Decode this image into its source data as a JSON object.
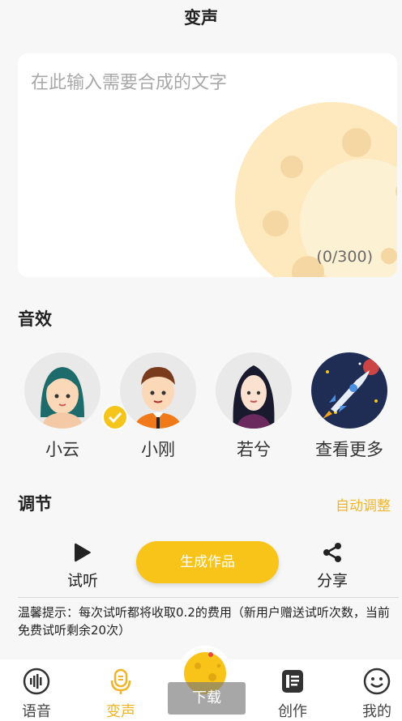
{
  "header": {
    "title": "变声"
  },
  "input": {
    "placeholder": "在此输入需要合成的文字",
    "counter": "(0/300)"
  },
  "effects": {
    "title": "音效",
    "voices": [
      {
        "name": "小云",
        "icon": "girl-avatar-icon",
        "selected": true
      },
      {
        "name": "小刚",
        "icon": "boy-avatar-icon",
        "selected": false
      },
      {
        "name": "若兮",
        "icon": "woman-avatar-icon",
        "selected": false
      },
      {
        "name": "查看更多",
        "icon": "rocket-icon",
        "selected": false
      }
    ]
  },
  "adjust": {
    "title": "调节",
    "auto_label": "自动调整"
  },
  "actions": {
    "preview_label": "试听",
    "generate_label": "生成作品",
    "share_label": "分享"
  },
  "tip": {
    "text": "温馨提示：每次试听都将收取0.2的费用（新用户赠送试听次数，当前免费试听剩余20次）"
  },
  "tabs": [
    {
      "label": "语音",
      "icon": "voice-wave-icon",
      "active": false
    },
    {
      "label": "变声",
      "icon": "microphone-icon",
      "active": true
    },
    {
      "label": "创作",
      "icon": "document-icon",
      "active": false
    },
    {
      "label": "我的",
      "icon": "smiley-icon",
      "active": false
    }
  ],
  "center": {
    "download_label": "下载"
  },
  "colors": {
    "accent": "#f8c41a",
    "accent_text": "#f0b429",
    "background": "#f7f7f7"
  }
}
